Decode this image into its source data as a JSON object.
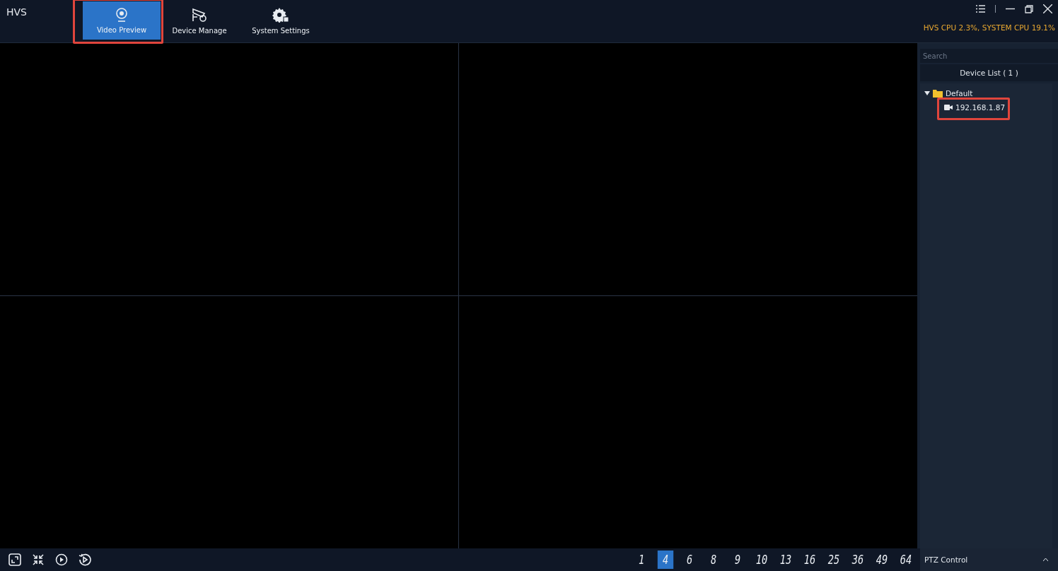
{
  "app_title": "HVS",
  "tabs": [
    {
      "label": "Video Preview",
      "selected": true,
      "highlighted": true
    },
    {
      "label": "Device Manage",
      "selected": false,
      "highlighted": false
    },
    {
      "label": "System Settings",
      "selected": false,
      "highlighted": false
    }
  ],
  "cpu_status": "HVS CPU 2.3%, SYSTEM CPU 19.1%",
  "sidebar": {
    "search": {
      "placeholder": "Search"
    },
    "device_list_title": "Device List ( 1 )",
    "tree": [
      {
        "label": "Default",
        "expanded": true,
        "children": [
          {
            "label": "192.168.1.87",
            "highlighted": true
          }
        ]
      }
    ]
  },
  "bottom_bar": {
    "layouts": [
      {
        "label": "1",
        "selected": false
      },
      {
        "label": "4",
        "selected": true
      },
      {
        "label": "6",
        "selected": false
      },
      {
        "label": "8",
        "selected": false
      },
      {
        "label": "9",
        "selected": false
      },
      {
        "label": "10",
        "selected": false
      },
      {
        "label": "13",
        "selected": false
      },
      {
        "label": "16",
        "selected": false
      },
      {
        "label": "25",
        "selected": false
      },
      {
        "label": "36",
        "selected": false
      },
      {
        "label": "49",
        "selected": false
      },
      {
        "label": "64",
        "selected": false
      }
    ],
    "ptz": {
      "label": "PTZ Control",
      "expanded": false
    }
  }
}
